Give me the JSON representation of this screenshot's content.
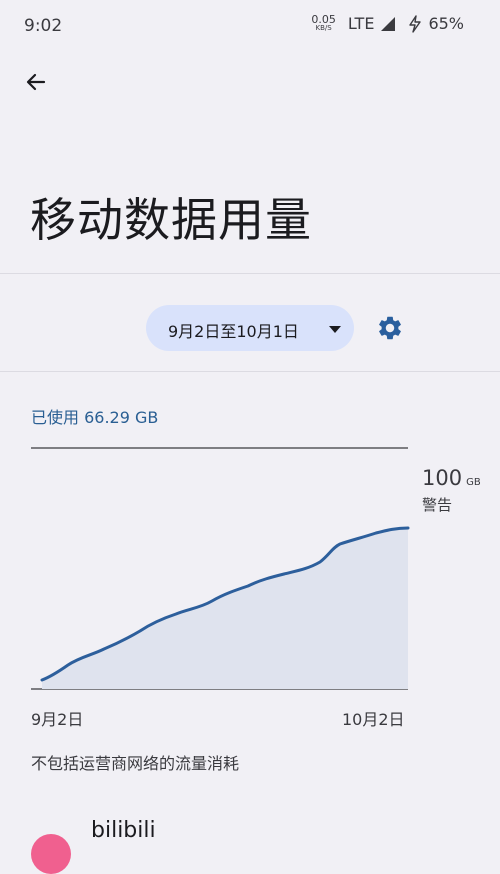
{
  "status_bar": {
    "time": "9:02",
    "net_speed_value": "0.05",
    "net_speed_unit": "KB/S",
    "network": "LTE",
    "battery": "65%"
  },
  "header": {
    "title": "移动数据用量"
  },
  "date_selector": {
    "range": "9月2日至10月1日"
  },
  "usage": {
    "used_text": "已使用 66.29 GB"
  },
  "chart_data": {
    "type": "area",
    "x_labels": [
      "9月2日",
      "10月2日"
    ],
    "limit_value": "100",
    "limit_unit": "GB",
    "limit_label": "警告",
    "color": "#2d5f9c"
  },
  "footnote": "不包括运营商网络的流量消耗",
  "apps": [
    {
      "name": "bilibili",
      "icon_color": "#f0608f"
    }
  ]
}
